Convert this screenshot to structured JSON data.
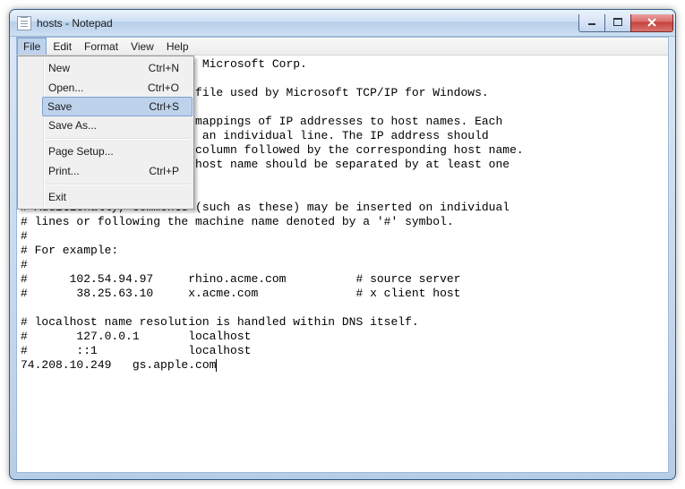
{
  "window": {
    "title": "hosts - Notepad"
  },
  "menubar": {
    "items": [
      "File",
      "Edit",
      "Format",
      "View",
      "Help"
    ],
    "open_index": 0
  },
  "file_menu": {
    "items": [
      {
        "label": "New",
        "shortcut": "Ctrl+N"
      },
      {
        "label": "Open...",
        "shortcut": "Ctrl+O"
      },
      {
        "label": "Save",
        "shortcut": "Ctrl+S",
        "highlighted": true
      },
      {
        "label": "Save As...",
        "shortcut": ""
      },
      {
        "separator": true
      },
      {
        "label": "Page Setup...",
        "shortcut": ""
      },
      {
        "label": "Print...",
        "shortcut": "Ctrl+P"
      },
      {
        "separator": true
      },
      {
        "label": "Exit",
        "shortcut": ""
      }
    ]
  },
  "document": {
    "text": "# Copyright (c) 1993-2009 Microsoft Corp.\n#\n# This is a sample HOSTS file used by Microsoft TCP/IP for Windows.\n#\n# This file contains the mappings of IP addresses to host names. Each\n# entry should be kept on an individual line. The IP address should\n# be placed in the first column followed by the corresponding host name.\n# The IP address and the host name should be separated by at least one\n# space.\n#\n# Additionally, comments (such as these) may be inserted on individual\n# lines or following the machine name denoted by a '#' symbol.\n#\n# For example:\n#\n#      102.54.94.97     rhino.acme.com          # source server\n#       38.25.63.10     x.acme.com              # x client host\n\n# localhost name resolution is handled within DNS itself.\n#       127.0.0.1       localhost\n#       ::1             localhost\n74.208.10.249   gs.apple.com"
  }
}
